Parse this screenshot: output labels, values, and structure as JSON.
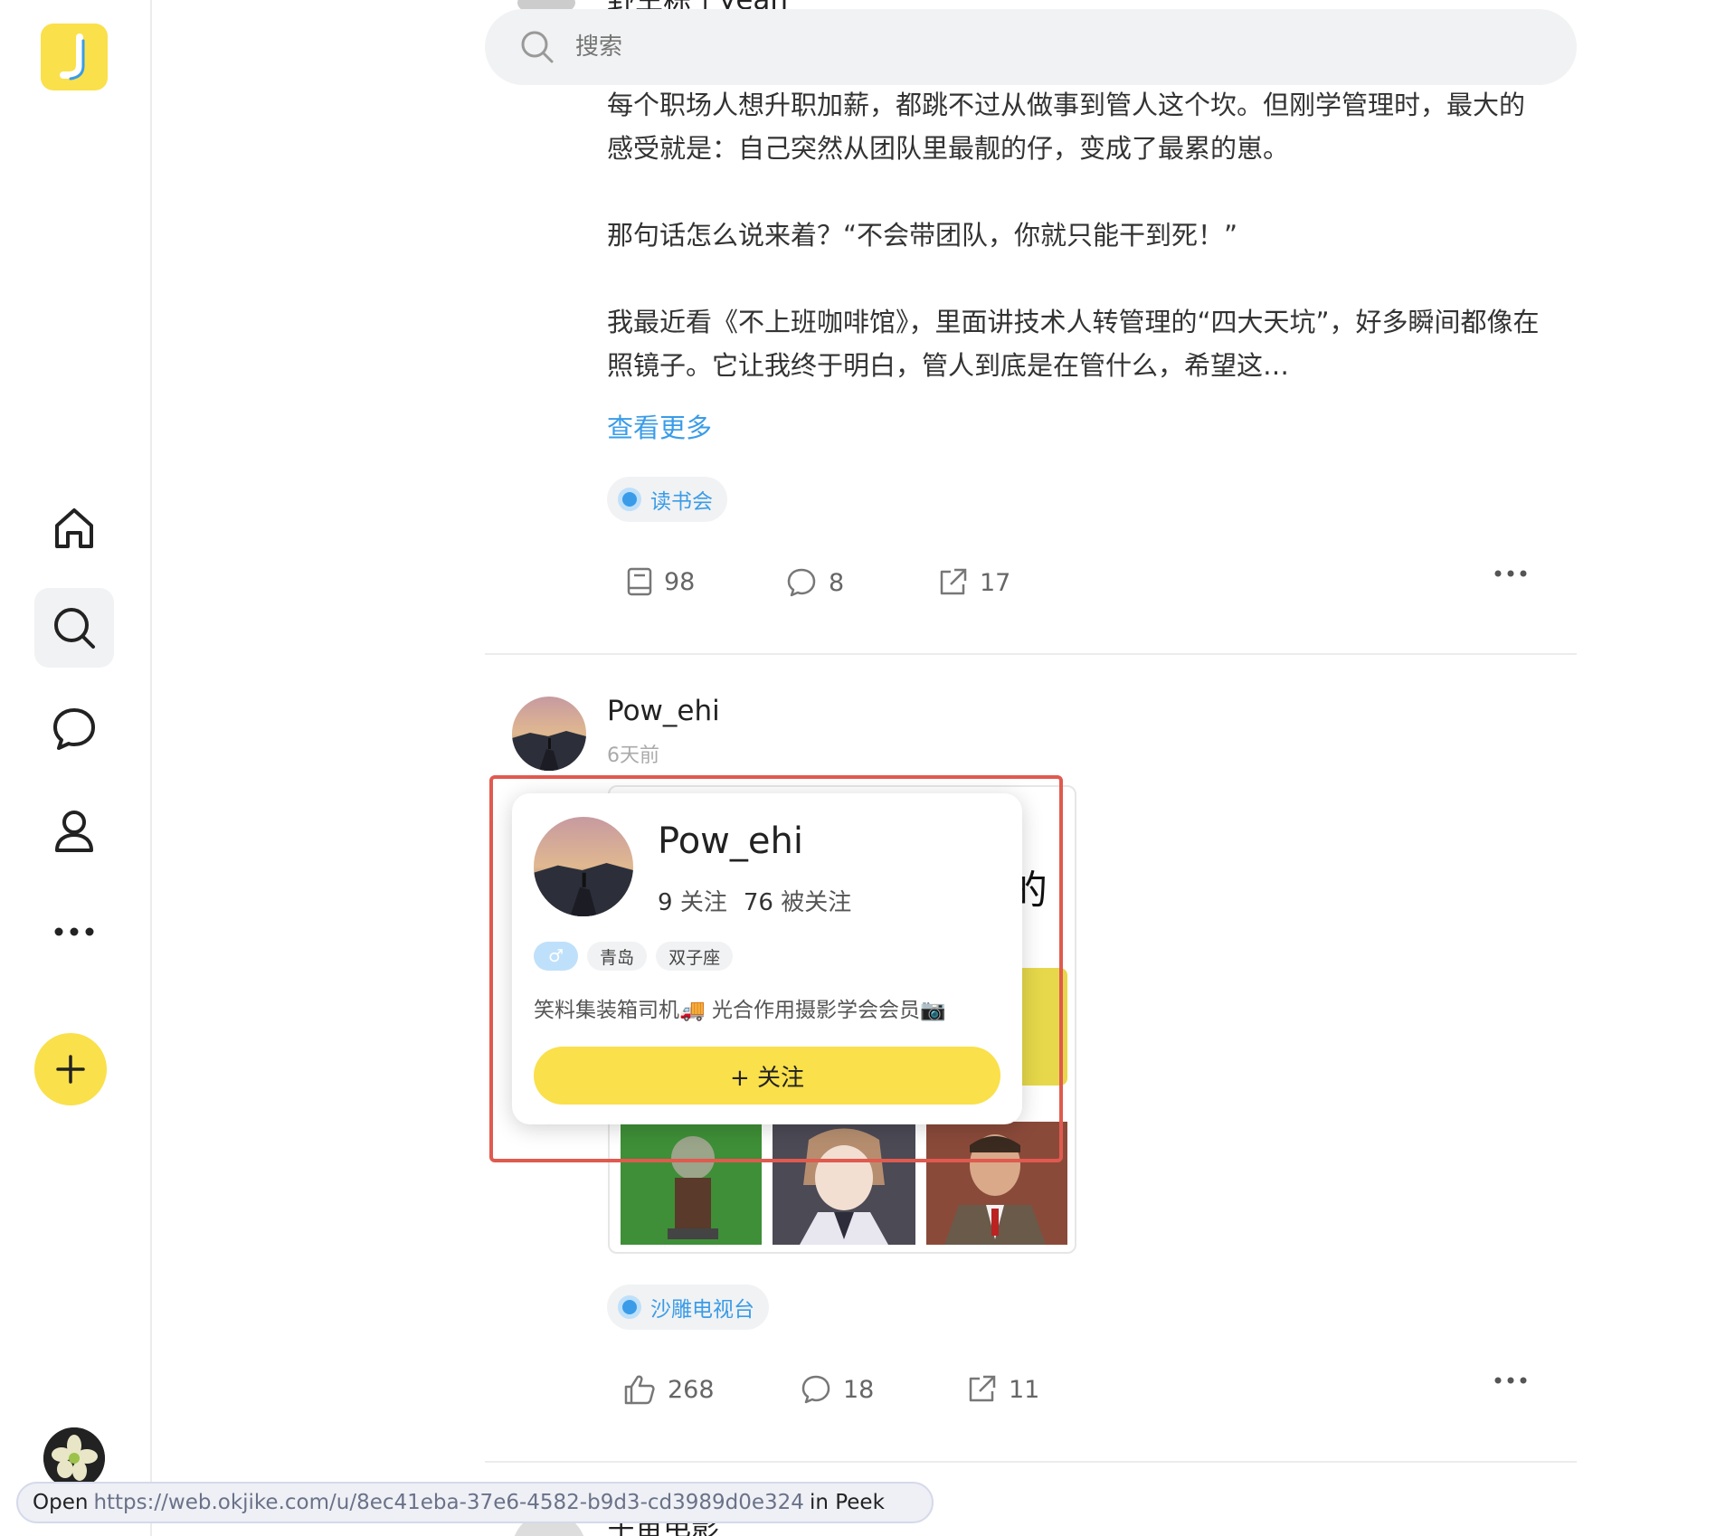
{
  "search": {
    "placeholder": "搜索"
  },
  "prev_post": {
    "peek_name": "野生粽子yeah",
    "paragraphs": [
      "每个职场人想升职加薪，都跳不过从做事到管人这个坎。但刚学管理时，最大的感受就是：自己突然从团队里最靓的仔，变成了最累的崽。",
      "那句话怎么说来着？“不会带团队，你就只能干到死！”",
      "我最近看《不上班咖啡馆》，里面讲技术人转管理的“四大天坑”，好多瞬间都像在照镜子。它让我终于明白，管人到底是在管什么，希望这…"
    ],
    "more_label": "查看更多",
    "topic": "读书会",
    "actions": {
      "reads": "98",
      "comments": "8",
      "shares": "17"
    }
  },
  "post2": {
    "username": "Pow_ehi",
    "time": "6天前",
    "image_caption_fragment": "的",
    "topic": "沙雕电视台",
    "actions": {
      "likes": "268",
      "comments": "18",
      "shares": "11"
    }
  },
  "popup": {
    "name": "Pow_ehi",
    "following_count": "9",
    "following_label": "关注",
    "followers_count": "76",
    "followers_label": "被关注",
    "gender": "♂",
    "tags": [
      "青岛",
      "双子座"
    ],
    "bio": "笑料集装箱司机🚚 光合作用摄影学会会员📷",
    "follow_label": "+ 关注"
  },
  "next_post": {
    "peek_name": "宇宙电影"
  },
  "statusbar": {
    "open": "Open",
    "url": "https://web.okjike.com/u/8ec41eba-37e6-4582-b9d3-cd3989d0e324",
    "suffix": "in Peek"
  },
  "colors": {
    "accent": "#fae04a",
    "link": "#3a9ce8",
    "highlight": "#e05a4f"
  }
}
